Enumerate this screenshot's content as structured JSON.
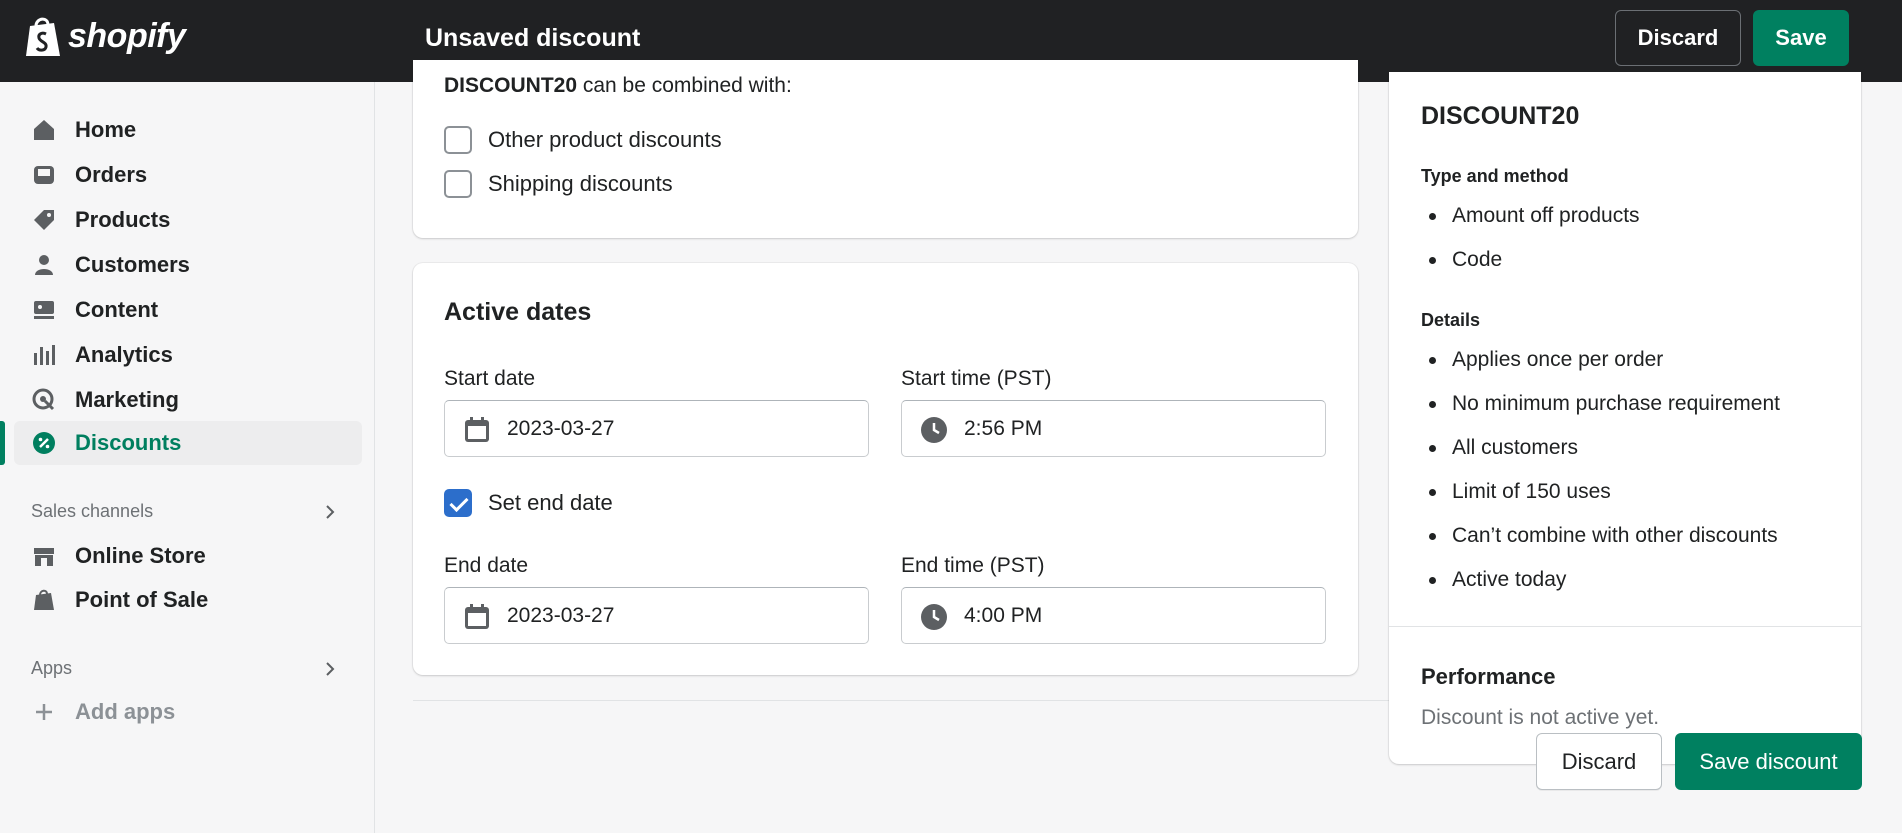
{
  "app": {
    "brand": "shopify",
    "title": "Unsaved discount"
  },
  "topbar": {
    "discard_label": "Discard",
    "save_label": "Save"
  },
  "sidebar": {
    "items": [
      {
        "label": "Home",
        "icon": "home-icon"
      },
      {
        "label": "Orders",
        "icon": "orders-icon"
      },
      {
        "label": "Products",
        "icon": "tag-icon"
      },
      {
        "label": "Customers",
        "icon": "person-icon"
      },
      {
        "label": "Content",
        "icon": "content-icon"
      },
      {
        "label": "Analytics",
        "icon": "bar-chart-icon"
      },
      {
        "label": "Marketing",
        "icon": "target-icon"
      },
      {
        "label": "Discounts",
        "icon": "discount-icon",
        "active": true
      }
    ],
    "sales_channels": {
      "heading": "Sales channels",
      "items": [
        {
          "label": "Online Store",
          "icon": "store-icon"
        },
        {
          "label": "Point of Sale",
          "icon": "pos-bag-icon"
        }
      ]
    },
    "apps": {
      "heading": "Apps",
      "add_label": "Add apps"
    }
  },
  "combinations": {
    "code": "DISCOUNT20",
    "suffix": " can be combined with:",
    "options": [
      {
        "label": "Other product discounts",
        "checked": false
      },
      {
        "label": "Shipping discounts",
        "checked": false
      }
    ]
  },
  "active_dates": {
    "title": "Active dates",
    "start_date_label": "Start date",
    "start_date": "2023-03-27",
    "start_time_label": "Start time (PST)",
    "start_time": "2:56 PM",
    "set_end_date_label": "Set end date",
    "set_end_date_checked": true,
    "end_date_label": "End date",
    "end_date": "2023-03-27",
    "end_time_label": "End time (PST)",
    "end_time": "4:00 PM"
  },
  "summary": {
    "code": "DISCOUNT20",
    "type_heading": "Type and method",
    "type_items": [
      "Amount off products",
      "Code"
    ],
    "details_heading": "Details",
    "details_items": [
      "Applies once per order",
      "No minimum purchase requirement",
      "All customers",
      "Limit of 150 uses",
      "Can’t combine with other discounts",
      "Active today"
    ],
    "performance_heading": "Performance",
    "performance_text": "Discount is not active yet."
  },
  "footer": {
    "discard_label": "Discard",
    "save_label": "Save discount"
  },
  "colors": {
    "primary": "#008060",
    "topbar": "#202123",
    "checkbox": "#2c6ecb",
    "active_nav": "#007f5f"
  }
}
